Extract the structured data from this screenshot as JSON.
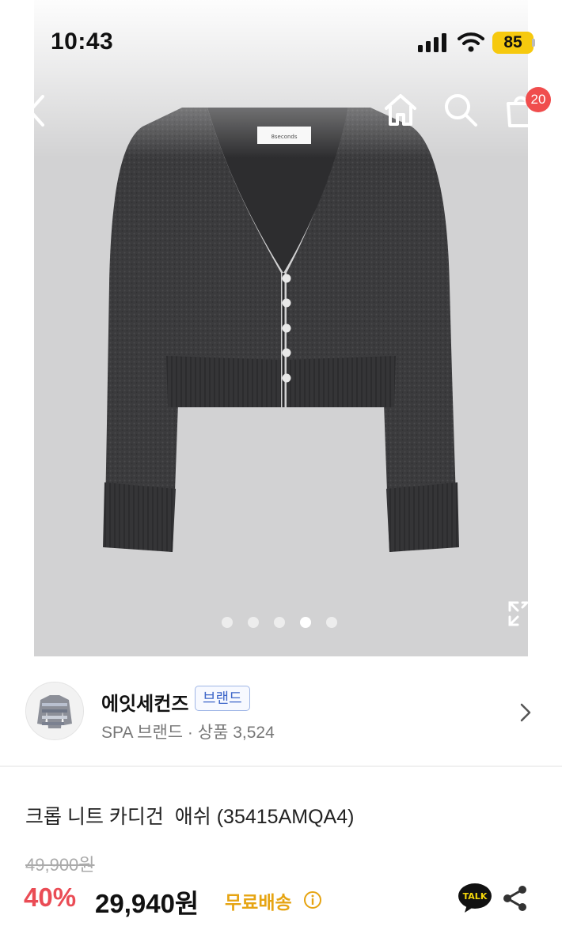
{
  "status_bar": {
    "time": "10:43",
    "battery": "85",
    "icons": [
      "signal-icon",
      "wifi-icon",
      "battery-icon"
    ]
  },
  "nav": {
    "icons": [
      "back-arrow-icon",
      "home-icon",
      "search-icon",
      "cart-icon"
    ],
    "cart_count": "20"
  },
  "carousel": {
    "total_slides": 5,
    "active_slide": 4,
    "product_label_text": "8seconds"
  },
  "brand": {
    "name": "에잇세컨즈",
    "tag": "브랜드",
    "subtitle": "SPA 브랜드 · 상품 3,524"
  },
  "product": {
    "title": "크롭 니트 카디건  애쉬 (35415AMQA4)",
    "original_price": "49,900원",
    "discount": "40%",
    "sale_price": "29,940원",
    "free_shipping": "무료배송",
    "talk_label": "TALK"
  },
  "colors": {
    "discount_red": "#ea4c55",
    "free_shipping_yellow": "#e6a412",
    "badge_red": "#f04d4d",
    "brand_tag_blue": "#3f67c9",
    "battery_yellow": "#f6c90e"
  }
}
